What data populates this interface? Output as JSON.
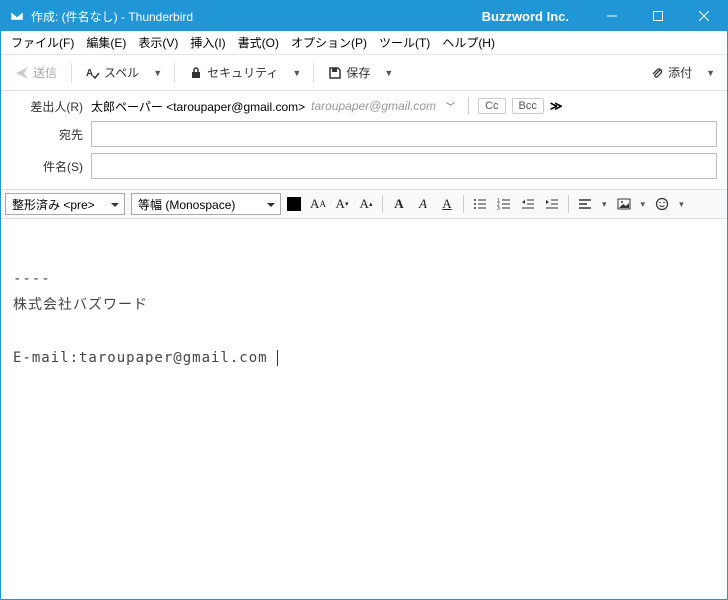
{
  "titlebar": {
    "title": "作成: (件名なし) - Thunderbird",
    "company": "Buzzword Inc."
  },
  "menu": {
    "file": "ファイル(F)",
    "edit": "編集(E)",
    "view": "表示(V)",
    "insert": "挿入(I)",
    "format": "書式(O)",
    "options": "オプション(P)",
    "tools": "ツール(T)",
    "help": "ヘルプ(H)"
  },
  "toolbar": {
    "send": "送信",
    "spell": "スペル",
    "security": "セキュリティ",
    "save": "保存",
    "attach": "添付"
  },
  "headers": {
    "from_label": "差出人(R)",
    "from_value": "太郎ペーパー <taroupaper@gmail.com>",
    "from_placeholder": "taroupaper@gmail.com",
    "to_label": "宛先",
    "subject_label": "件名(S)",
    "cc": "Cc",
    "bcc": "Bcc"
  },
  "format": {
    "para": "整形済み <pre>",
    "font": "等幅 (Monospace)"
  },
  "body": {
    "sep": "----",
    "company": "株式会社バズワード",
    "email": "E-mail:taroupaper@gmail.com"
  }
}
